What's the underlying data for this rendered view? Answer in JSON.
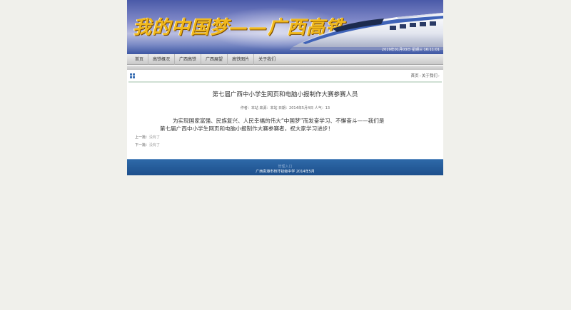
{
  "banner": {
    "title": "我的中国梦——广西高铁",
    "datetime": "2019年01月03日 星期三 16:11:01",
    "colors": {
      "title": "#f0b81c",
      "sky": "#4a5aa8"
    }
  },
  "nav": {
    "items": [
      {
        "label": "首页"
      },
      {
        "label": "高铁概况"
      },
      {
        "label": "广西高铁"
      },
      {
        "label": "广西展望"
      },
      {
        "label": "高铁图片"
      },
      {
        "label": "关于我们"
      }
    ]
  },
  "breadcrumb": {
    "icon": "grid-icon",
    "home": "首页",
    "current": "关于我们"
  },
  "article": {
    "title": "第七届广西中小学生网页和电脑小报制作大赛参赛人员",
    "meta": "作者：本站 来源：本站 日期：2014年5月4日 人气：13",
    "body_line1": "为实现国家富强、民族复兴、人民幸福的伟大“中国梦”而发奋学习、不懈奋斗——我们是",
    "body_line2": "第七届广西中小学生网页和电脑小报制作大赛参赛者，祝大家学习进步！",
    "prev_label": "上一篇：",
    "prev_value": "没有了",
    "next_label": "下一篇：",
    "next_value": "没有了"
  },
  "footer": {
    "admin_link": "管理入口",
    "copyright": "广西贵港市桥圩初级中学 2014年5月",
    "colors": {
      "background": "#1d4f8c"
    }
  }
}
